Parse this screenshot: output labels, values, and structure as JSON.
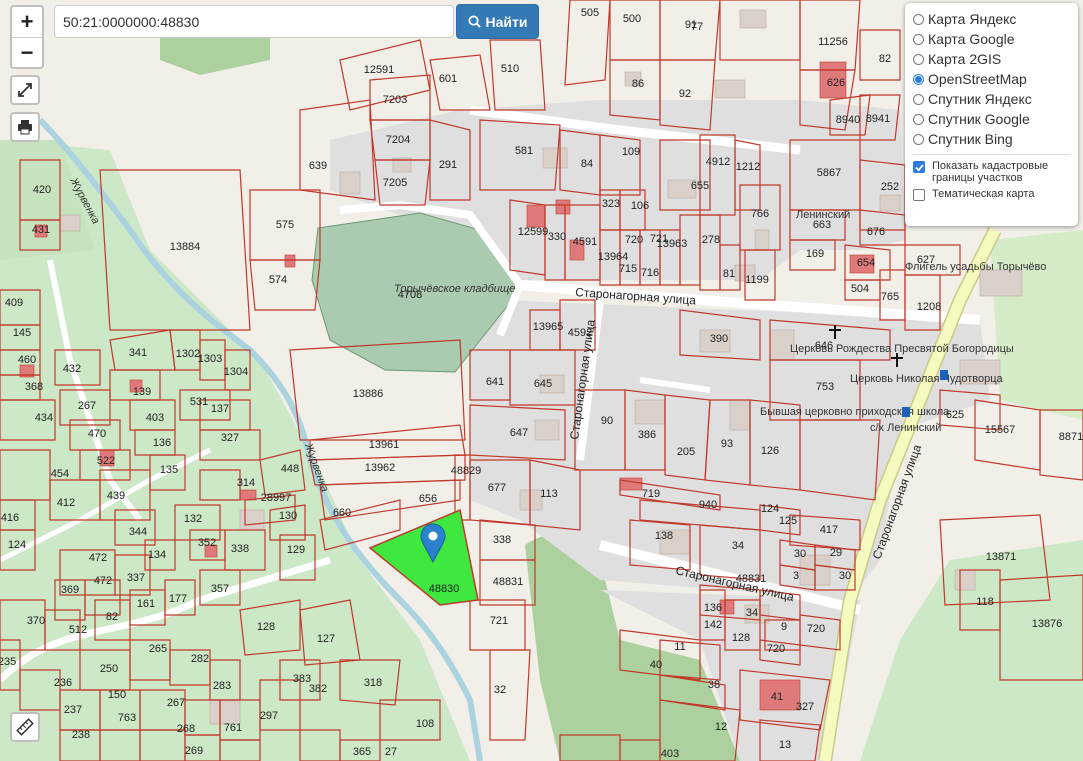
{
  "search": {
    "value": "50:21:0000000:48830",
    "button_label": "Найти"
  },
  "zoom": {
    "in_label": "+",
    "out_label": "−"
  },
  "layers": {
    "base": [
      {
        "label": "Карта Яндекс",
        "selected": false
      },
      {
        "label": "Карта Google",
        "selected": false
      },
      {
        "label": "Карта 2GIS",
        "selected": false
      },
      {
        "label": "OpenStreetMap",
        "selected": true
      },
      {
        "label": "Спутник Яндекс",
        "selected": false
      },
      {
        "label": "Спутник Google",
        "selected": false
      },
      {
        "label": "Спутник Bing",
        "selected": false
      }
    ],
    "overlays": [
      {
        "label": "Показать кадастровые границы участков",
        "checked": true
      },
      {
        "label": "Тематическая карта",
        "checked": false
      }
    ]
  },
  "map": {
    "streets": {
      "staronagornaya": "Старонагорная улица",
      "zhurvenka": "Журвенка"
    },
    "places": {
      "cemetery": "Торычёвское кладбище",
      "church_christmas": "Церковь Рождества Пресвятой Богородицы",
      "church_nicholas": "Церковь Николая Чудотворца",
      "school": "Бывшая церковно приходская школа",
      "manor": "Флигель усадьбы Торычёво",
      "leninsky": "Ленинский",
      "stop": "с/х Ленинский"
    },
    "selected_plot": {
      "number": "48830"
    },
    "plots": [
      {
        "n": "505"
      },
      {
        "n": "500"
      },
      {
        "n": "91"
      },
      {
        "n": "77"
      },
      {
        "n": "11256"
      },
      {
        "n": "82"
      },
      {
        "n": "12591"
      },
      {
        "n": "601"
      },
      {
        "n": "510"
      },
      {
        "n": "86"
      },
      {
        "n": "92"
      },
      {
        "n": "626"
      },
      {
        "n": "8940"
      },
      {
        "n": "8941"
      },
      {
        "n": "7203"
      },
      {
        "n": "7204"
      },
      {
        "n": "7205"
      },
      {
        "n": "291"
      },
      {
        "n": "639"
      },
      {
        "n": "581"
      },
      {
        "n": "84"
      },
      {
        "n": "109"
      },
      {
        "n": "655"
      },
      {
        "n": "4912"
      },
      {
        "n": "1212"
      },
      {
        "n": "5867"
      },
      {
        "n": "252"
      },
      {
        "n": "420"
      },
      {
        "n": "431"
      },
      {
        "n": "13884"
      },
      {
        "n": "575"
      },
      {
        "n": "574"
      },
      {
        "n": "12599"
      },
      {
        "n": "330"
      },
      {
        "n": "4591"
      },
      {
        "n": "323"
      },
      {
        "n": "106"
      },
      {
        "n": "766"
      },
      {
        "n": "663"
      },
      {
        "n": "676"
      },
      {
        "n": "169"
      },
      {
        "n": "654"
      },
      {
        "n": "627"
      },
      {
        "n": "13964"
      },
      {
        "n": "715"
      },
      {
        "n": "720"
      },
      {
        "n": "716"
      },
      {
        "n": "721"
      },
      {
        "n": "13963"
      },
      {
        "n": "278"
      },
      {
        "n": "81"
      },
      {
        "n": "1199"
      },
      {
        "n": "504"
      },
      {
        "n": "765"
      },
      {
        "n": "1208"
      },
      {
        "n": "4708"
      },
      {
        "n": "409"
      },
      {
        "n": "145"
      },
      {
        "n": "460"
      },
      {
        "n": "368"
      },
      {
        "n": "434"
      },
      {
        "n": "341"
      },
      {
        "n": "1302"
      },
      {
        "n": "1303"
      },
      {
        "n": "1304"
      },
      {
        "n": "432"
      },
      {
        "n": "139"
      },
      {
        "n": "531"
      },
      {
        "n": "267"
      },
      {
        "n": "403"
      },
      {
        "n": "137"
      },
      {
        "n": "470"
      },
      {
        "n": "136"
      },
      {
        "n": "327"
      },
      {
        "n": "522"
      },
      {
        "n": "135"
      },
      {
        "n": "13965"
      },
      {
        "n": "4592"
      },
      {
        "n": "641"
      },
      {
        "n": "645"
      },
      {
        "n": "390"
      },
      {
        "n": "646"
      },
      {
        "n": "753"
      },
      {
        "n": "625"
      },
      {
        "n": "15567"
      },
      {
        "n": "8871"
      },
      {
        "n": "13886"
      },
      {
        "n": "647"
      },
      {
        "n": "90"
      },
      {
        "n": "386"
      },
      {
        "n": "205"
      },
      {
        "n": "93"
      },
      {
        "n": "126"
      },
      {
        "n": "454"
      },
      {
        "n": "412"
      },
      {
        "n": "439"
      },
      {
        "n": "113"
      },
      {
        "n": "314"
      },
      {
        "n": "448"
      },
      {
        "n": "28997"
      },
      {
        "n": "130"
      },
      {
        "n": "13961"
      },
      {
        "n": "13962"
      },
      {
        "n": "48829"
      },
      {
        "n": "677"
      },
      {
        "n": "656"
      },
      {
        "n": "660"
      },
      {
        "n": "719"
      },
      {
        "n": "940"
      },
      {
        "n": "124"
      },
      {
        "n": "125"
      },
      {
        "n": "417"
      },
      {
        "n": "416"
      },
      {
        "n": "124"
      },
      {
        "n": "344"
      },
      {
        "n": "132"
      },
      {
        "n": "352"
      },
      {
        "n": "338"
      },
      {
        "n": "129"
      },
      {
        "n": "134"
      },
      {
        "n": "138"
      },
      {
        "n": "34"
      },
      {
        "n": "30"
      },
      {
        "n": "29"
      },
      {
        "n": "3"
      },
      {
        "n": "30"
      },
      {
        "n": "13871"
      },
      {
        "n": "472"
      },
      {
        "n": "337"
      },
      {
        "n": "369"
      },
      {
        "n": "472"
      },
      {
        "n": "161"
      },
      {
        "n": "177"
      },
      {
        "n": "357"
      },
      {
        "n": "338"
      },
      {
        "n": "48831"
      },
      {
        "n": "48831"
      },
      {
        "n": "34"
      },
      {
        "n": "136"
      },
      {
        "n": "142"
      },
      {
        "n": "128"
      },
      {
        "n": "9"
      },
      {
        "n": "720"
      },
      {
        "n": "720"
      },
      {
        "n": "118"
      },
      {
        "n": "13876"
      },
      {
        "n": "370"
      },
      {
        "n": "512"
      },
      {
        "n": "82"
      },
      {
        "n": "128"
      },
      {
        "n": "127"
      },
      {
        "n": "721"
      },
      {
        "n": "11"
      },
      {
        "n": "40"
      },
      {
        "n": "235"
      },
      {
        "n": "250"
      },
      {
        "n": "265"
      },
      {
        "n": "282"
      },
      {
        "n": "283"
      },
      {
        "n": "383"
      },
      {
        "n": "382"
      },
      {
        "n": "318"
      },
      {
        "n": "38"
      },
      {
        "n": "41"
      },
      {
        "n": "327"
      },
      {
        "n": "32"
      },
      {
        "n": "236"
      },
      {
        "n": "150"
      },
      {
        "n": "237"
      },
      {
        "n": "763"
      },
      {
        "n": "267"
      },
      {
        "n": "297"
      },
      {
        "n": "108"
      },
      {
        "n": "761"
      },
      {
        "n": "268"
      },
      {
        "n": "238"
      },
      {
        "n": "269"
      },
      {
        "n": "12"
      },
      {
        "n": "403"
      },
      {
        "n": "13"
      },
      {
        "n": "365"
      },
      {
        "n": "27"
      }
    ]
  },
  "colors": {
    "plot_border": "#c0392b",
    "selected_fill": "#3ee83e",
    "road": "#ffffff",
    "main_road": "#f7fabf",
    "residential": "#dcdcdc",
    "forest": "#add19e",
    "cemetery": "#aacbaf",
    "water": "#aad3df",
    "accent": "#337ab7"
  },
  "icons": {
    "zoom_in": "plus-icon",
    "zoom_out": "minus-icon",
    "fullscreen": "fullscreen-icon",
    "print": "printer-icon",
    "ruler": "ruler-icon",
    "search": "search-icon",
    "marker": "location-marker-icon",
    "church": "cross-icon"
  }
}
